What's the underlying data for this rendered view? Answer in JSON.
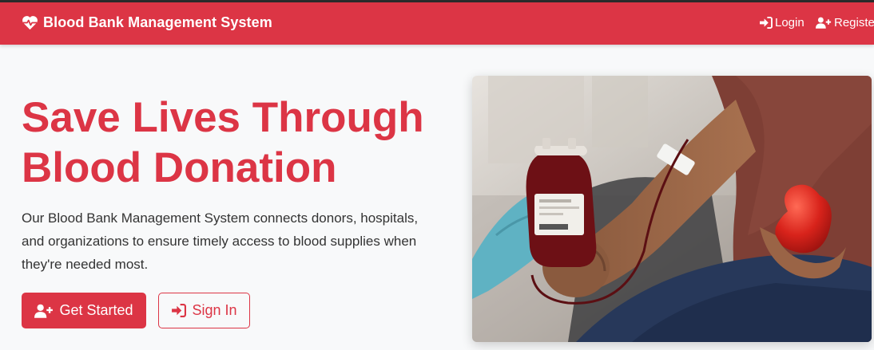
{
  "navbar": {
    "brand": "Blood Bank Management System",
    "login_label": "Login",
    "register_label": "Register"
  },
  "hero": {
    "title_line1": "Save Lives Through",
    "title_line2": "Blood Donation",
    "description": "Our Blood Bank Management System connects donors, hospitals, and organizations to ensure timely access to blood supplies when they're needed most.",
    "primary_button": "Get Started",
    "secondary_button": "Sign In",
    "image_icon": "blood-donation-photo"
  },
  "colors": {
    "brand": "#dc3545",
    "background": "#f8f9fa",
    "text": "#333333"
  }
}
